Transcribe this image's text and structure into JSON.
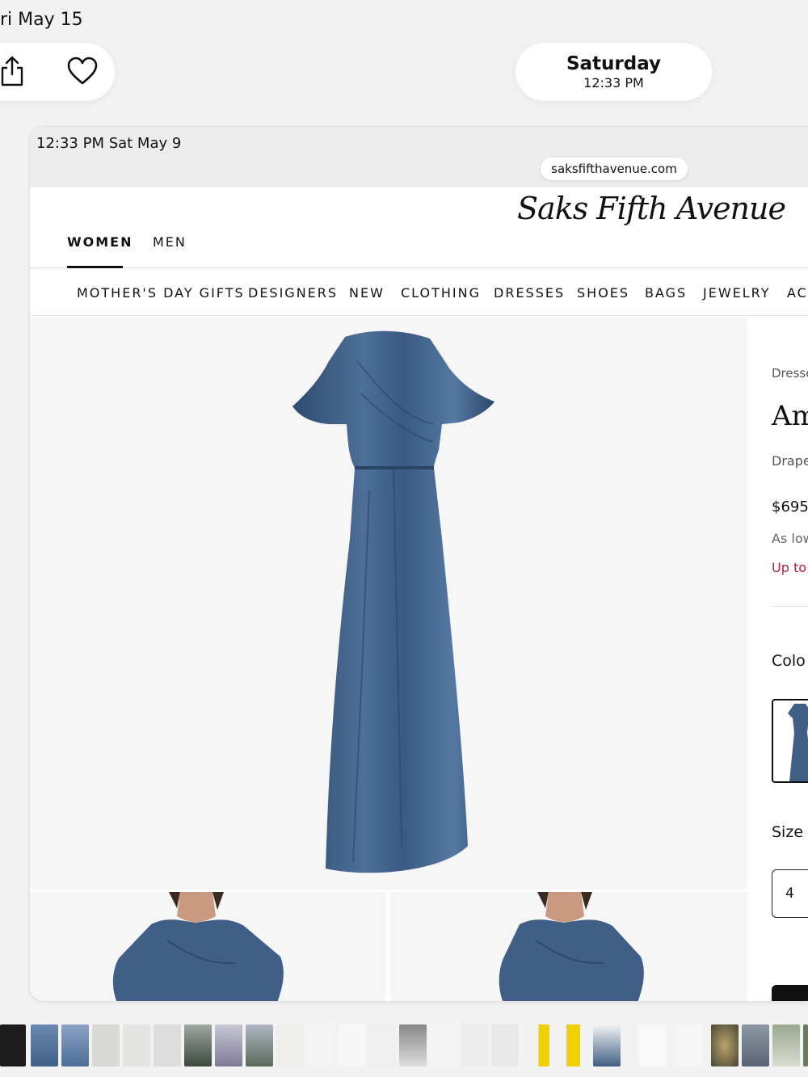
{
  "viewer": {
    "date_label": "ri May 15",
    "info_day": "Saturday",
    "info_time": "12:33 PM"
  },
  "device": {
    "status_time_date": "12:33 PM   Sat May 9",
    "url": "saksfifthavenue.com"
  },
  "site": {
    "logo_text": "Saks Fifth Avenue",
    "gender_tabs": [
      "WOMEN",
      "MEN"
    ],
    "active_gender": "WOMEN",
    "categories": [
      "MOTHER'S DAY GIFTS",
      "DESIGNERS",
      "NEW",
      "CLOTHING",
      "DRESSES",
      "SHOES",
      "BAGS",
      "JEWELRY",
      "ACC"
    ]
  },
  "product": {
    "breadcrumb": "Dresse",
    "name": "Am",
    "subtitle": "Drape",
    "price": "$695",
    "installments": "As low",
    "promo": "Up to",
    "color_label": "Colo",
    "size_label": "Size",
    "selected_size": "4"
  },
  "colors": {
    "dress": "#3f5f86",
    "promo_red": "#b0233b",
    "background": "#f2f2f3"
  }
}
